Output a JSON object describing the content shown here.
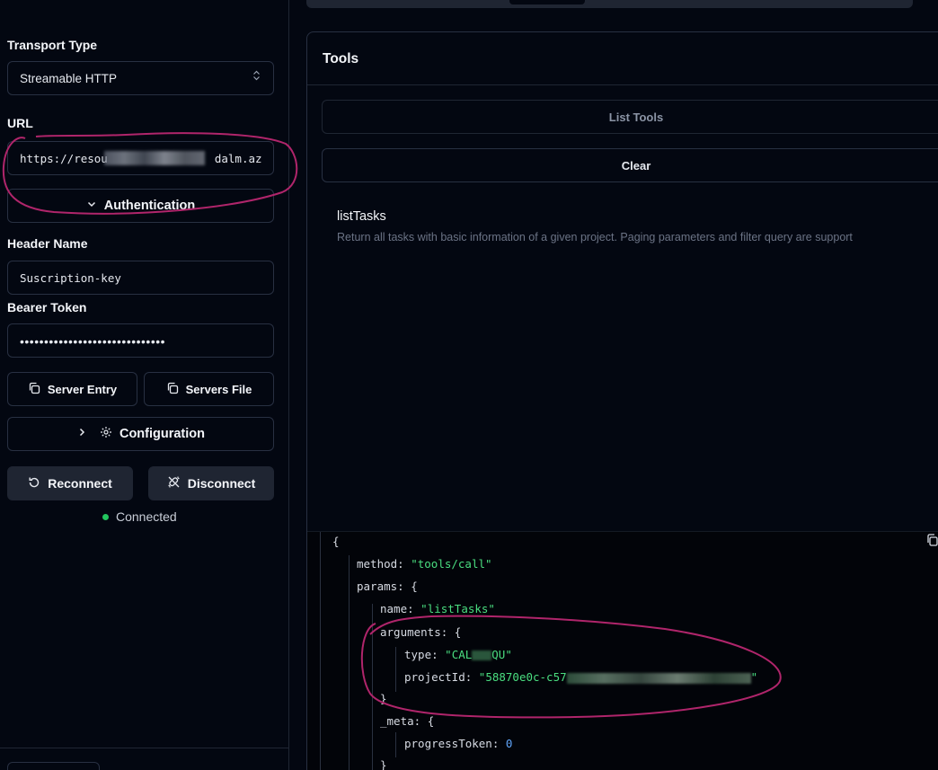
{
  "sidebar": {
    "transport_label": "Transport Type",
    "transport_value": "Streamable HTTP",
    "url_label": "URL",
    "url_value_start": "https://resou",
    "url_value_end": "dalm.az",
    "auth_label": "Authentication",
    "header_name_label": "Header Name",
    "header_name_value": "Suscription-key",
    "bearer_label": "Bearer Token",
    "bearer_value": "••••••••••••••••••••••••••••••",
    "server_entry_label": "Server Entry",
    "servers_file_label": "Servers File",
    "configuration_label": "Configuration",
    "reconnect_label": "Reconnect",
    "disconnect_label": "Disconnect",
    "status_label": "Connected"
  },
  "main": {
    "tools_title": "Tools",
    "list_tools_label": "List Tools",
    "clear_label": "Clear",
    "tool": {
      "name": "listTasks",
      "description": "Return all tasks with basic information of a given project. Paging parameters and filter query are support"
    }
  },
  "request_json": {
    "open_brace": "{",
    "method_key": "method:",
    "method_val": "\"tools/call\"",
    "params_key": "params:",
    "params_open": "{",
    "name_key": "name:",
    "name_val": "\"listTasks\"",
    "arguments_key": "arguments:",
    "arguments_open": "{",
    "type_key": "type:",
    "type_val_start": "\"CAL",
    "type_val_end": "QU\"",
    "projectId_key": "projectId:",
    "projectId_val_start": "\"58870e0c-c57",
    "projectId_val_end": "\"",
    "arguments_close": "}",
    "meta_key": "_meta:",
    "meta_open": "{",
    "progress_key": "progressToken:",
    "progress_val": "0",
    "meta_close": "}"
  },
  "colors": {
    "background": "#030711",
    "border": "#283042",
    "status_green": "#22c55e",
    "json_string": "#4ade80",
    "json_number": "#60a5fa",
    "annotation": "#b0256b"
  }
}
